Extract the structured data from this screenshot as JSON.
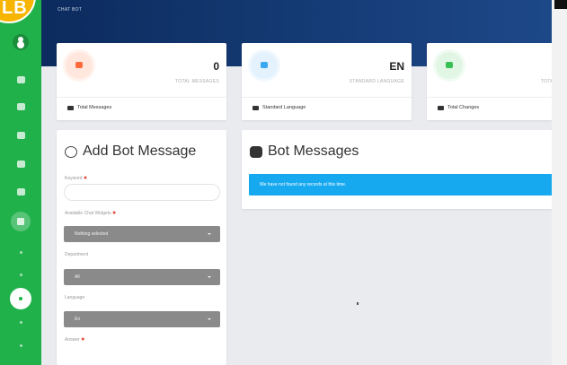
{
  "brand": {
    "badge_text": "LB",
    "badge_color": "#f7b500"
  },
  "colors": {
    "sidebar": "#21b14b",
    "topbar": "#0c2b5e",
    "info": "#17a9f0"
  },
  "topbar": {
    "breadcrumb": "CHAT BOT"
  },
  "stats": [
    {
      "icon": "robot-icon",
      "icon_color": "#ff6a3d",
      "value": "0",
      "label": "TOTAL MESSAGES",
      "footer": "Total Messages"
    },
    {
      "icon": "language-icon",
      "icon_color": "#3aa8f0",
      "value": "EN",
      "label": "STANDARD LANGUAGE",
      "footer": "Standard Language"
    },
    {
      "icon": "changes-icon",
      "icon_color": "#39c052",
      "value": "",
      "label": "TOTA",
      "footer": "Total Changes"
    }
  ],
  "add_form": {
    "title": "Add Bot Message",
    "keyword_label": "Keyword",
    "chat_widgets_label": "Available Chat Widgets",
    "chat_widgets_value": "Nothing selected",
    "department_label": "Department",
    "department_value": "All",
    "language_label": "Language",
    "language_value": "En",
    "answer_label": "Answer"
  },
  "messages": {
    "title": "Bot Messages",
    "empty_text": "We have not found any records at this time."
  }
}
